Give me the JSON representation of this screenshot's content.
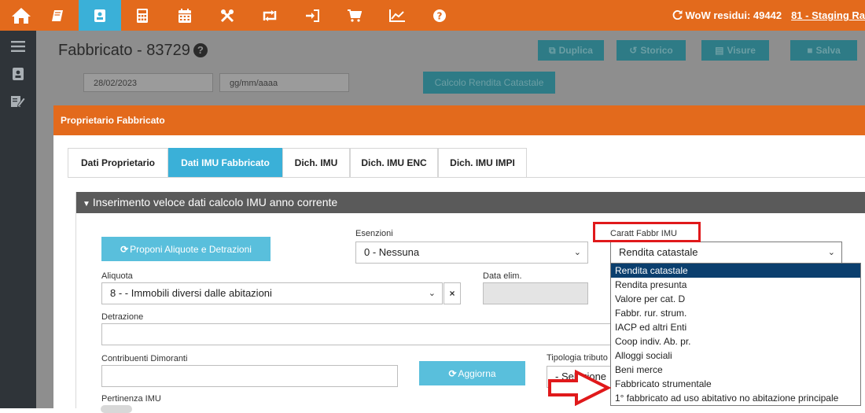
{
  "topbar": {
    "wow_label": "WoW residui: 49442",
    "link_label": "81 - Staging Ra",
    "icons": [
      "home-icon",
      "book-icon",
      "id-card-icon",
      "calculator-icon",
      "calendar-icon",
      "tools-icon",
      "retweet-icon",
      "sign-in-icon",
      "cart-icon",
      "chart-icon",
      "question-icon"
    ]
  },
  "page": {
    "title": "Fabbricato - 83729",
    "buttons": {
      "duplica": "Duplica",
      "storico": "Storico",
      "visure": "Visure",
      "salva": "Salva"
    },
    "date_value": "28/02/2023",
    "date_placeholder": "gg/mm/aaaa",
    "calc_button": "Calcolo Rendita Catastale"
  },
  "modal": {
    "title": "Proprietario Fabbricato",
    "tabs": [
      "Dati Proprietario",
      "Dati IMU Fabbricato",
      "Dich. IMU",
      "Dich. IMU ENC",
      "Dich. IMU IMPI"
    ],
    "active_tab": 1,
    "panel_title": "Inserimento veloce dati calcolo IMU anno corrente",
    "propose_button": "Proponi Aliquote e Detrazioni",
    "esenzioni_label": "Esenzioni",
    "esenzioni_value": "0 - Nessuna",
    "caratt_label": "Caratt Fabbr IMU",
    "caratt_value": "Rendita catastale",
    "aliquota_label": "Aliquota",
    "aliquota_value": "8 - - Immobili diversi dalle abitazioni",
    "data_elim_label": "Data elim.",
    "detrazione_label": "Detrazione",
    "contribuenti_label": "Contribuenti Dimoranti",
    "aggiorna_button": "Aggiorna",
    "tipologia_label": "Tipologia tributo",
    "tipologia_value": "- Selezione",
    "pertinenza_label": "Pertinenza IMU"
  },
  "dropdown": {
    "selected_index": 0,
    "options": [
      "Rendita catastale",
      "Rendita presunta",
      "Valore per cat. D",
      "Fabbr. rur. strum.",
      "IACP ed altri Enti",
      "Coop indiv. Ab. pr.",
      "Alloggi sociali",
      "Beni merce",
      "Fabbricato strumentale",
      "1° fabbricato ad uso abitativo no abitazione principale"
    ]
  },
  "colors": {
    "accent_orange": "#e36a1c",
    "accent_blue": "#3ab0d8",
    "highlight_red": "#e0191b",
    "selected_option": "#0b3f6e"
  }
}
